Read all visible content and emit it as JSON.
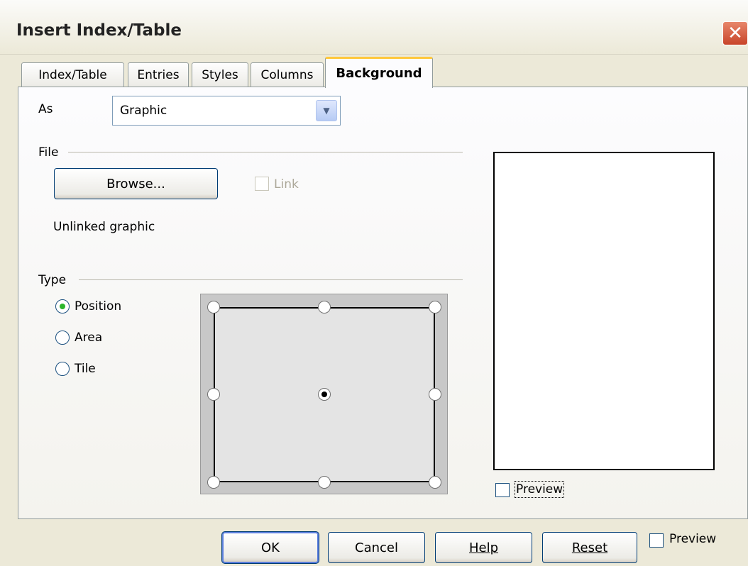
{
  "window": {
    "title": "Insert Index/Table",
    "close_label": "✕"
  },
  "tabs": [
    {
      "label": "Index/Table"
    },
    {
      "label": "Entries"
    },
    {
      "label": "Styles"
    },
    {
      "label": "Columns"
    },
    {
      "label": "Background"
    }
  ],
  "as": {
    "label": "As",
    "value": "Graphic"
  },
  "file": {
    "section_label": "File",
    "browse_label": "Browse...",
    "link_label": "Link",
    "status": "Unlinked graphic"
  },
  "type": {
    "section_label": "Type",
    "options": [
      {
        "label": "Position",
        "selected": true
      },
      {
        "label": "Area",
        "selected": false
      },
      {
        "label": "Tile",
        "selected": false
      }
    ]
  },
  "preview_panel": {
    "preview_label": "Preview"
  },
  "footer": {
    "ok_label": "OK",
    "cancel_label": "Cancel",
    "help_label": "Help",
    "reset_label": "Reset",
    "preview_label": "Preview"
  },
  "colors": {
    "dialog_bg": "#ece9d8",
    "tab_accent": "#ffc83c",
    "radio_selected": "#2bb52b",
    "close_button": "#c8442a"
  }
}
